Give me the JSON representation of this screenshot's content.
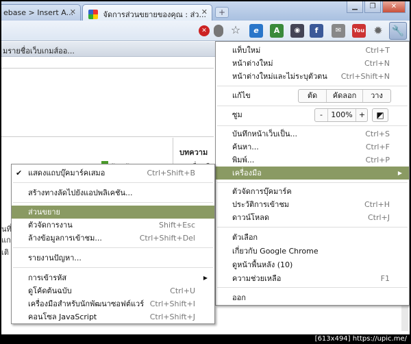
{
  "tabs": [
    {
      "label": "ebase > Insert A..."
    },
    {
      "label": "จัดการส่วนขยายของคุณ : ส่ว..."
    }
  ],
  "toolbar_icons": [
    "stop-icon",
    "bulb-icon",
    "star-icon",
    "ie-icon",
    "translate-icon",
    "camera-icon",
    "facebook-icon",
    "gmail-icon",
    "youtube-icon",
    "gear-icon",
    "wrench-icon"
  ],
  "page": {
    "bar_text": "มรายชื่อเว็บเกมส์ออ...",
    "side_title": "บทความ",
    "side_snip1": "เครื่องมื",
    "side_snip2": "ร้านด้วย",
    "left_snip1": "นที่",
    "left_snip2": "แก",
    "left_snip3": "เติ"
  },
  "main_menu": {
    "new_tab": {
      "label": "แท็บใหม่",
      "shortcut": "Ctrl+T"
    },
    "new_window": {
      "label": "หน้าต่างใหม่",
      "shortcut": "Ctrl+N"
    },
    "incognito": {
      "label": "หน้าต่างใหม่และไม่ระบุตัวตน",
      "shortcut": "Ctrl+Shift+N"
    },
    "edit": {
      "label": "แก้ไข",
      "cut": "ตัด",
      "copy": "คัดลอก",
      "paste": "วาง"
    },
    "zoom": {
      "label": "ซูม",
      "minus": "-",
      "value": "100%",
      "plus": "+"
    },
    "save_page": {
      "label": "บันทึกหน้าเว็บเป็น...",
      "shortcut": "Ctrl+S"
    },
    "find": {
      "label": "ค้นหา...",
      "shortcut": "Ctrl+F"
    },
    "print": {
      "label": "พิมพ์...",
      "shortcut": "Ctrl+P"
    },
    "tools": {
      "label": "เครื่องมือ"
    },
    "bookmark_mgr": {
      "label": "ตัวจัดการบุ๊คมาร์ค"
    },
    "history": {
      "label": "ประวัติการเข้าชม",
      "shortcut": "Ctrl+H"
    },
    "downloads": {
      "label": "ดาวน์โหลด",
      "shortcut": "Ctrl+J"
    },
    "options": {
      "label": "ตัวเลือก"
    },
    "about": {
      "label": "เกี่ยวกับ Google Chrome"
    },
    "background": {
      "label": "ดูหน้าพื้นหลัง (10)"
    },
    "help": {
      "label": "ความช่วยเหลือ",
      "shortcut": "F1"
    },
    "exit": {
      "label": "ออก"
    }
  },
  "tools_menu": {
    "bookmark_bar": {
      "label": "แสดงแถบบุ๊คมาร์คเสมอ",
      "shortcut": "Ctrl+Shift+B"
    },
    "app_shortcut": {
      "label": "สร้างทางลัดไปยังแอปพลิเคชัน..."
    },
    "extensions": {
      "label": "ส่วนขยาย"
    },
    "task_manager": {
      "label": "ตัวจัดการงาน",
      "shortcut": "Shift+Esc"
    },
    "clear_data": {
      "label": "ล้างข้อมูลการเข้าชม...",
      "shortcut": "Ctrl+Shift+Del"
    },
    "report_issue": {
      "label": "รายงานปัญหา..."
    },
    "encoding": {
      "label": "การเข้ารหัส"
    },
    "view_source": {
      "label": "ดูโค้ดต้นฉบับ",
      "shortcut": "Ctrl+U"
    },
    "dev_tools": {
      "label": "เครื่องมือสำหรับนักพัฒนาซอฟต์แวร์",
      "shortcut": "Ctrl+Shift+I"
    },
    "js_console": {
      "label": "คอนโซล JavaScript",
      "shortcut": "Ctrl+Shift+J"
    }
  },
  "watermark": "[613x494] https://upic.me/",
  "colors": {
    "highlight": "#8a9a63",
    "titlebar": "#b7cbe6"
  }
}
